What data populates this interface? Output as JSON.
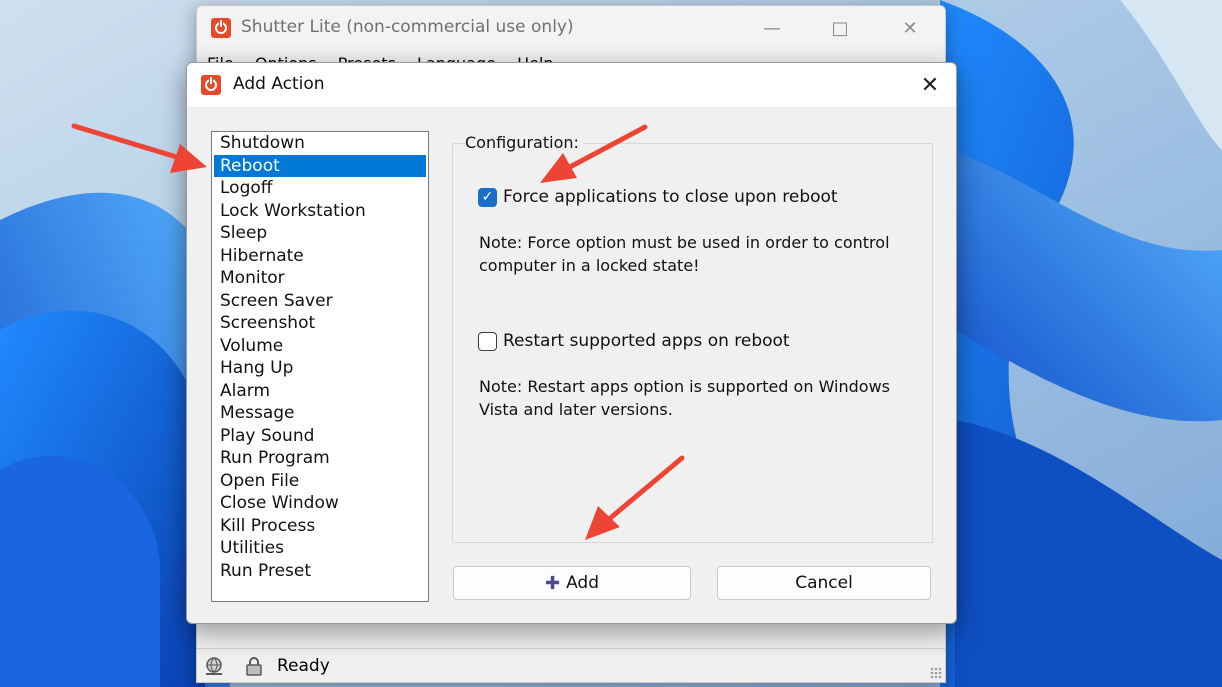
{
  "main_window": {
    "title": "Shutter Lite (non-commercial use only)",
    "menu": [
      "File",
      "Options",
      "Presets",
      "Language",
      "Help"
    ],
    "status": "Ready"
  },
  "dialog": {
    "title": "Add Action",
    "actions": [
      "Shutdown",
      "Reboot",
      "Logoff",
      "Lock Workstation",
      "Sleep",
      "Hibernate",
      "Monitor",
      "Screen Saver",
      "Screenshot",
      "Volume",
      "Hang Up",
      "Alarm",
      "Message",
      "Play Sound",
      "Run Program",
      "Open File",
      "Close Window",
      "Kill Process",
      "Utilities",
      "Run Preset"
    ],
    "selected_action": "Reboot",
    "config": {
      "legend": "Configuration:",
      "force_label": "Force applications to close upon reboot",
      "force_checked": true,
      "force_note": [
        "Note: Force option must be used in order to control",
        "computer in a locked state!"
      ],
      "restart_label": "Restart supported apps on reboot",
      "restart_checked": false,
      "restart_note": [
        "Note: Restart apps option is supported on Windows",
        "Vista and later versions."
      ]
    },
    "add_label": "Add",
    "cancel_label": "Cancel"
  },
  "colors": {
    "selection": "#0078d7",
    "checkbox_checked": "#1c6fc8",
    "app_icon": "#e84a27",
    "annotation_arrow": "#ee4435"
  },
  "icons": [
    "app-power-icon",
    "close-icon",
    "minimize-icon",
    "maximize-icon",
    "check-icon",
    "plus-icon",
    "globe-icon",
    "lock-icon"
  ]
}
